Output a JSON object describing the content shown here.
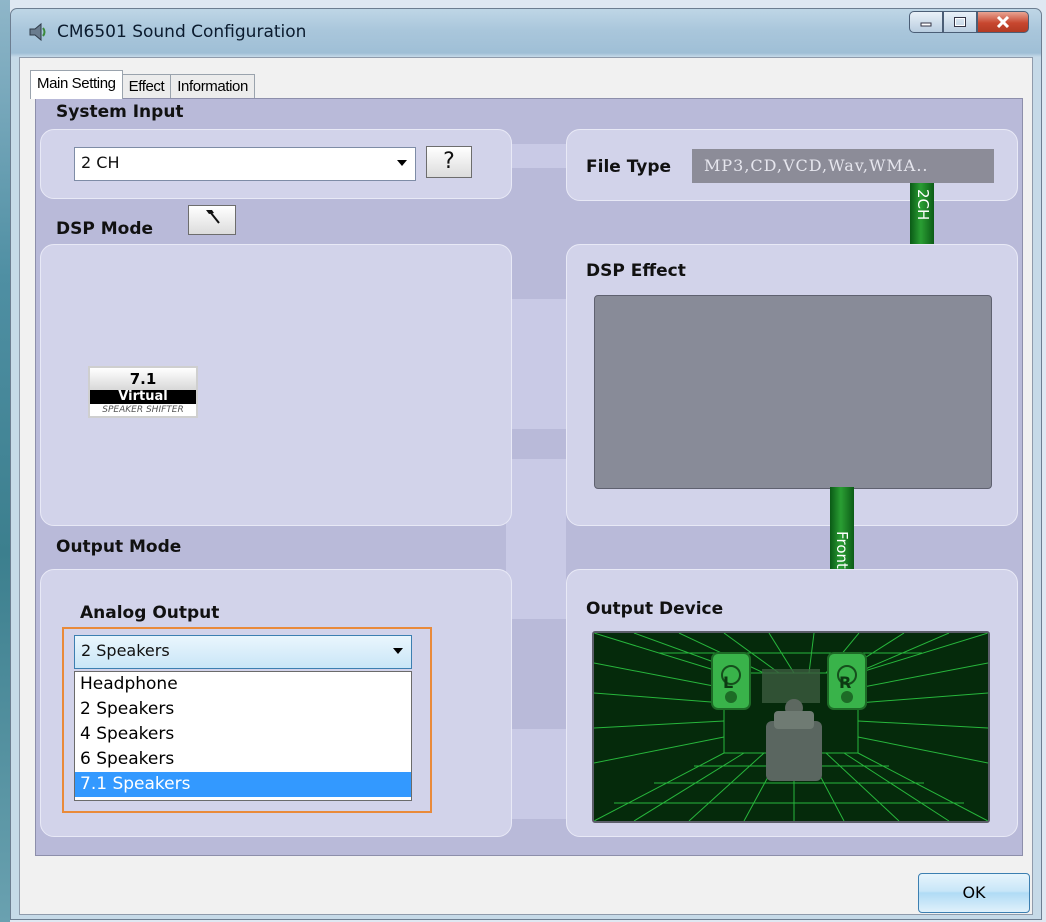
{
  "window": {
    "title": "CM6501 Sound Configuration",
    "icon": "speaker-app-icon",
    "controls": [
      "minimize-icon",
      "maximize-icon",
      "close-icon"
    ]
  },
  "tabs": [
    {
      "label": "Main Setting",
      "active": true
    },
    {
      "label": "Effect",
      "active": false
    },
    {
      "label": "Information",
      "active": false
    }
  ],
  "system_input": {
    "heading": "System Input",
    "selected": "2 CH",
    "help_label": "?"
  },
  "file_type": {
    "label": "File Type",
    "value": "MP3,CD,VCD,Wav,WMA.."
  },
  "channel_tag": "2CH",
  "dsp_mode": {
    "heading": "DSP Mode",
    "tool_icon": "hammer-icon",
    "badge": {
      "top": "7.1",
      "middle": "Virtual",
      "bottom": "SPEAKER SHIFTER"
    }
  },
  "dsp_effect": {
    "heading": "DSP Effect"
  },
  "front_tag": "Front",
  "output_mode": {
    "heading": "Output Mode",
    "analog_label": "Analog Output",
    "selected": "2 Speakers",
    "options": [
      "Headphone",
      "2 Speakers",
      "4 Speakers",
      "6 Speakers",
      "7.1 Speakers"
    ],
    "highlighted_option": "7.1 Speakers"
  },
  "output_device": {
    "heading": "Output Device",
    "left_speaker": "L",
    "right_speaker": "R"
  },
  "footer": {
    "ok_label": "OK"
  },
  "colors": {
    "panel": "#b9bad9",
    "box": "#d2d3ea",
    "green": "#2a9e33",
    "highlight": "#e98a3a",
    "selection": "#3399ff"
  }
}
